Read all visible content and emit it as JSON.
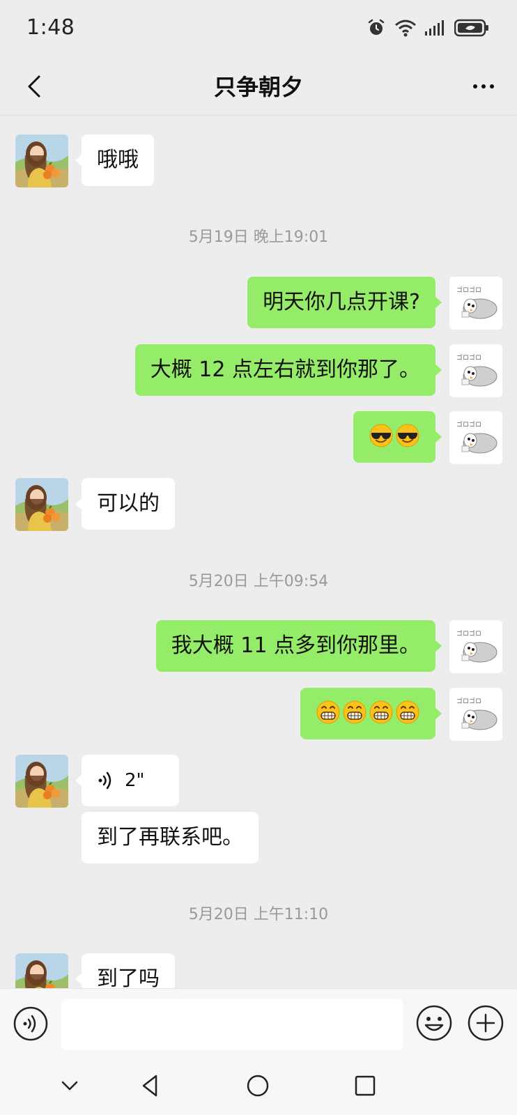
{
  "status_bar": {
    "time": "1:48"
  },
  "header": {
    "title": "只争朝夕"
  },
  "messages": {
    "m1": {
      "text": "哦哦"
    },
    "ts1": {
      "text": "5月19日 晚上19:01"
    },
    "m2": {
      "text": "明天你几点开课?"
    },
    "m3": {
      "text": "大概 12 点左右就到你那了。"
    },
    "m4": {
      "emoji": "sunglasses-emoji ×2"
    },
    "m5": {
      "text": "可以的"
    },
    "ts2": {
      "text": "5月20日 上午09:54"
    },
    "m6": {
      "text": "我大概 11 点多到你那里。"
    },
    "m7": {
      "emoji": "grin-emoji ×4"
    },
    "m8": {
      "voice_duration": "2\""
    },
    "m9": {
      "text": "到了再联系吧。"
    },
    "ts3": {
      "text": "5月20日 上午11:10"
    },
    "m10": {
      "text": "到了吗"
    }
  },
  "colors": {
    "outgoing_bubble": "#95ec69",
    "incoming_bubble": "#ffffff",
    "background": "#ededed"
  },
  "input": {
    "value": "",
    "placeholder": ""
  }
}
